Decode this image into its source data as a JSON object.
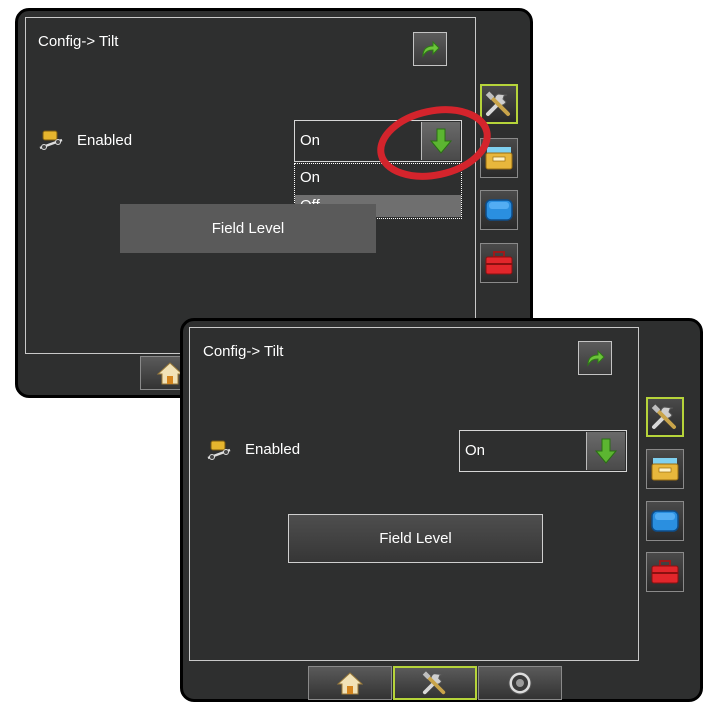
{
  "screen_back": {
    "title": "Config-> Tilt",
    "tilt_label": "Enabled",
    "tilt_value": "On",
    "dropdown_options": [
      "On",
      "Off"
    ],
    "field_level_label": "Field Level"
  },
  "screen_front": {
    "title": "Config-> Tilt",
    "tilt_label": "Enabled",
    "tilt_value": "On",
    "field_level_label": "Field Level"
  },
  "side_tabs": [
    "tools-icon",
    "archive-box-icon",
    "display-icon",
    "toolbox-icon"
  ],
  "bottom_tabs": [
    "home-icon",
    "tools-icon",
    "gauge-icon"
  ],
  "colors": {
    "screen_bg": "#2e2f2f",
    "accent_green": "#b6d43a",
    "arrow_green": "#5cb531",
    "highlight_red": "#d4242c"
  }
}
